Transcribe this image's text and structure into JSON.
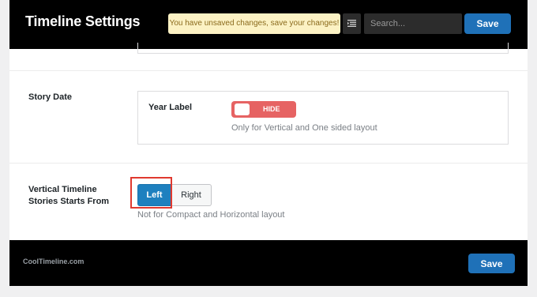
{
  "header": {
    "title": "Timeline Settings",
    "notice": "You have unsaved changes, save your changes!",
    "list_icon": "list-icon",
    "search_placeholder": "Search...",
    "save_label": "Save"
  },
  "story_date": {
    "label": "Story Date",
    "year_label": "Year Label",
    "toggle_text": "HIDE",
    "toggle_state": "off",
    "help": "Only for Vertical and One sided layout"
  },
  "vertical_start": {
    "label_line1": "Vertical Timeline",
    "label_line2": "Stories Starts From",
    "options": [
      "Left",
      "Right"
    ],
    "selected": "Left",
    "help": "Not for Compact and Horizontal layout"
  },
  "footer": {
    "brand": "CoolTimeline.com",
    "save_label": "Save"
  },
  "colors": {
    "header_bg": "#000000",
    "accent": "#1f71b8",
    "toggle_off": "#e66363",
    "notice_bg": "#fcf2c4",
    "highlight": "#e0392f"
  }
}
